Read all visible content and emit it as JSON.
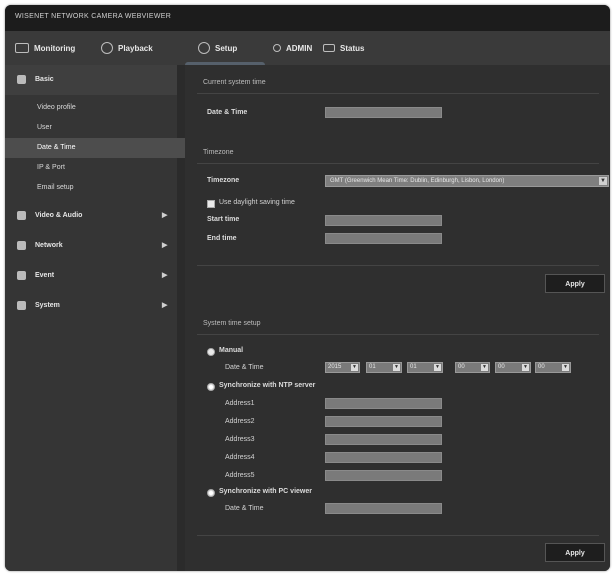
{
  "window": {
    "title": "WISENET NETWORK CAMERA WEBVIEWER"
  },
  "nav": {
    "monitoring": "Monitoring",
    "playback": "Playback",
    "setup": "Setup",
    "user": "ADMIN",
    "status": "Status"
  },
  "sidebar": {
    "header": "Basic",
    "sub_items": [
      "Video profile",
      "User",
      "Date & Time",
      "IP & Port",
      "Email setup"
    ],
    "selected": "Date & Time",
    "main_items": [
      "Video & Audio",
      "Network",
      "Event",
      "System"
    ]
  },
  "content": {
    "current_system_time": {
      "title": "Current system time",
      "date_time_label": "Date & Time",
      "date_time_value": ""
    },
    "timezone": {
      "title": "Timezone",
      "timezone_label": "Timezone",
      "timezone_value": "GMT (Greenwich Mean Time: Dublin, Edinburgh, Lisbon, London)",
      "dst_label": "Use daylight saving time",
      "start_time_label": "Start time",
      "end_time_label": "End time",
      "apply_label": "Apply"
    },
    "system_time_setup": {
      "title": "System time setup",
      "manual_label": "Manual",
      "manual_date_time_label": "Date & Time",
      "ntp_label": "Synchronize with NTP server",
      "address_labels": [
        "Address1",
        "Address2",
        "Address3",
        "Address4",
        "Address5"
      ],
      "pc_label": "Synchronize with PC viewer",
      "pc_date_time_label": "Date & Time",
      "apply_label": "Apply",
      "manual_selects": [
        "2015",
        "01",
        "01",
        "00",
        "00",
        "00"
      ]
    }
  }
}
